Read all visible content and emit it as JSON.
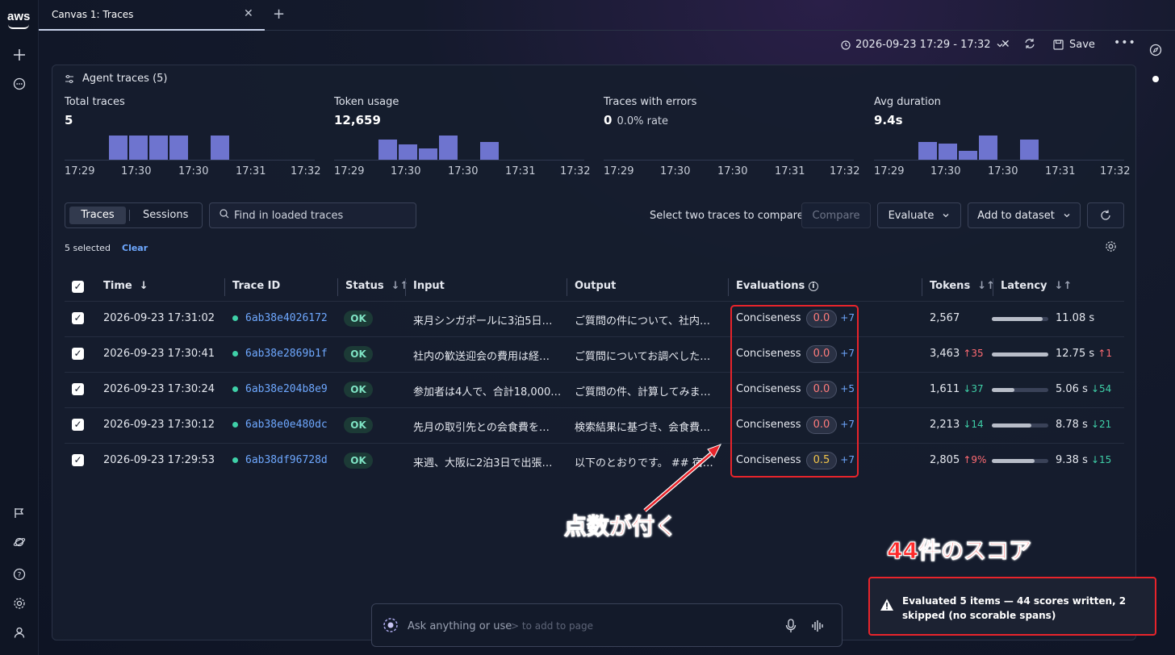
{
  "app": {
    "logo": "aws"
  },
  "tabs": [
    {
      "label": "Canvas 1: Traces"
    }
  ],
  "toolbar": {
    "time_range": "2026-09-23 17:29 - 17:32",
    "save_label": "Save"
  },
  "panel": {
    "title": "Agent traces (5)",
    "stats": [
      {
        "label": "Total traces",
        "value": "5",
        "sub": "",
        "bars": [
          1,
          1,
          1,
          1,
          0,
          1
        ],
        "axis": [
          "17:29",
          "17:30",
          "17:30",
          "17:31",
          "17:32"
        ]
      },
      {
        "label": "Token usage",
        "value": "12,659",
        "sub": "",
        "bars": [
          0.82,
          0.62,
          0.45,
          1,
          0,
          0.72
        ],
        "axis": [
          "17:29",
          "17:30",
          "17:30",
          "17:31",
          "17:32"
        ]
      },
      {
        "label": "Traces with errors",
        "value": "0",
        "sub": "0.0% rate",
        "bars": [
          0,
          0,
          0,
          0,
          0,
          0
        ],
        "axis": [
          "17:29",
          "17:30",
          "17:30",
          "17:31",
          "17:32"
        ]
      },
      {
        "label": "Avg duration",
        "value": "9.4s",
        "sub": "",
        "bars": [
          0.72,
          0.68,
          0.38,
          1,
          0,
          0.82
        ],
        "axis": [
          "17:29",
          "17:30",
          "17:30",
          "17:31",
          "17:32"
        ]
      }
    ]
  },
  "controls": {
    "seg_traces": "Traces",
    "seg_sessions": "Sessions",
    "search_placeholder": "Find in loaded traces",
    "compare_hint": "Select two traces to compare",
    "compare_label": "Compare",
    "evaluate_label": "Evaluate",
    "add_dataset_label": "Add to dataset",
    "selected_text": "5 selected",
    "clear_label": "Clear"
  },
  "table": {
    "headers": {
      "time": "Time",
      "trace_id": "Trace ID",
      "status": "Status",
      "input": "Input",
      "output": "Output",
      "evaluations": "Evaluations",
      "tokens": "Tokens",
      "latency": "Latency"
    },
    "rows": [
      {
        "time": "2026-09-23 17:31:02",
        "trace_id": "6ab38e4026172",
        "status": "OK",
        "input": "来月シンガポールに3泊5日…",
        "output": "ご質問の件について、社内…",
        "eval_name": "Conciseness",
        "eval_score": "0.0",
        "eval_more": "+7",
        "tokens": "2,567",
        "tok_delta": "",
        "tok_dir": "",
        "latency_fill": 0.9,
        "latency": "11.08 s",
        "lat_delta": "",
        "lat_dir": ""
      },
      {
        "time": "2026-09-23 17:30:41",
        "trace_id": "6ab38e2869b1f",
        "status": "OK",
        "input": "社内の歓送迎会の費用は経…",
        "output": "ご質問についてお調べした…",
        "eval_name": "Conciseness",
        "eval_score": "0.0",
        "eval_more": "+7",
        "tokens": "3,463",
        "tok_delta": "↑35",
        "tok_dir": "up",
        "latency_fill": 1.0,
        "latency": "12.75 s",
        "lat_delta": "↑1",
        "lat_dir": "up"
      },
      {
        "time": "2026-09-23 17:30:24",
        "trace_id": "6ab38e204b8e9",
        "status": "OK",
        "input": "参加者は4人で、合計18,000…",
        "output": "ご質問の件、計算してみま…",
        "eval_name": "Conciseness",
        "eval_score": "0.0",
        "eval_more": "+5",
        "tokens": "1,611",
        "tok_delta": "↓37",
        "tok_dir": "down",
        "latency_fill": 0.4,
        "latency": "5.06 s",
        "lat_delta": "↓54",
        "lat_dir": "down"
      },
      {
        "time": "2026-09-23 17:30:12",
        "trace_id": "6ab38e0e480dc",
        "status": "OK",
        "input": "先月の取引先との会食費を…",
        "output": "検索結果に基づき、会食費…",
        "eval_name": "Conciseness",
        "eval_score": "0.0",
        "eval_more": "+7",
        "tokens": "2,213",
        "tok_delta": "↓14",
        "tok_dir": "down",
        "latency_fill": 0.7,
        "latency": "8.78 s",
        "lat_delta": "↓21",
        "lat_dir": "down"
      },
      {
        "time": "2026-09-23 17:29:53",
        "trace_id": "6ab38df96728d",
        "status": "OK",
        "input": "来週、大阪に2泊3日で出張…",
        "output": "以下のとおりです。 ## 宿…",
        "eval_name": "Conciseness",
        "eval_score": "0.5",
        "eval_more": "+7",
        "tokens": "2,805",
        "tok_delta": "↑9%",
        "tok_dir": "up",
        "latency_fill": 0.75,
        "latency": "9.38 s",
        "lat_delta": "↓15",
        "lat_dir": "down"
      }
    ]
  },
  "annotations": {
    "score_note": "点数が付く",
    "count_note": "44件のスコア"
  },
  "prompt": {
    "placeholder": "Ask anything or use",
    "hint": "> to add to page"
  },
  "toast": {
    "message": "Evaluated 5 items — 44 scores written, 2 skipped (no scorable spans)"
  },
  "colors": {
    "accent": "#6ea8ff",
    "bar": "#6e74cf",
    "ok": "#3fd0a8",
    "score_zero": "#ff7b7b",
    "score_mid": "#f3c64a",
    "annotation": "#e8242b"
  }
}
